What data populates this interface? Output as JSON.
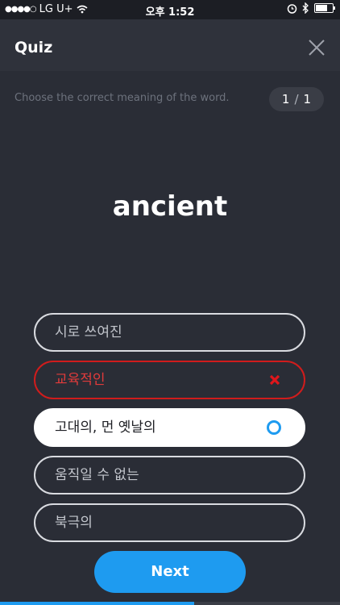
{
  "status_bar": {
    "carrier": "LG U+",
    "time": "오후 1:52",
    "signal_dots": "●●●●○"
  },
  "header": {
    "title": "Quiz"
  },
  "quiz": {
    "instruction": "Choose the correct meaning of the word.",
    "current": "1",
    "separator": "/",
    "total": "1",
    "word": "ancient",
    "options": [
      {
        "label": "시로 쓰여진",
        "state": "default"
      },
      {
        "label": "교육적인",
        "state": "wrong"
      },
      {
        "label": "고대의, 먼 옛날의",
        "state": "correct"
      },
      {
        "label": "움직일 수 없는",
        "state": "default"
      },
      {
        "label": "북극의",
        "state": "default"
      }
    ]
  },
  "next_label": "Next",
  "progress": 0.57,
  "colors": {
    "background": "#2a2d36",
    "accent": "#1e9bf0",
    "wrong": "#d01c1c"
  }
}
